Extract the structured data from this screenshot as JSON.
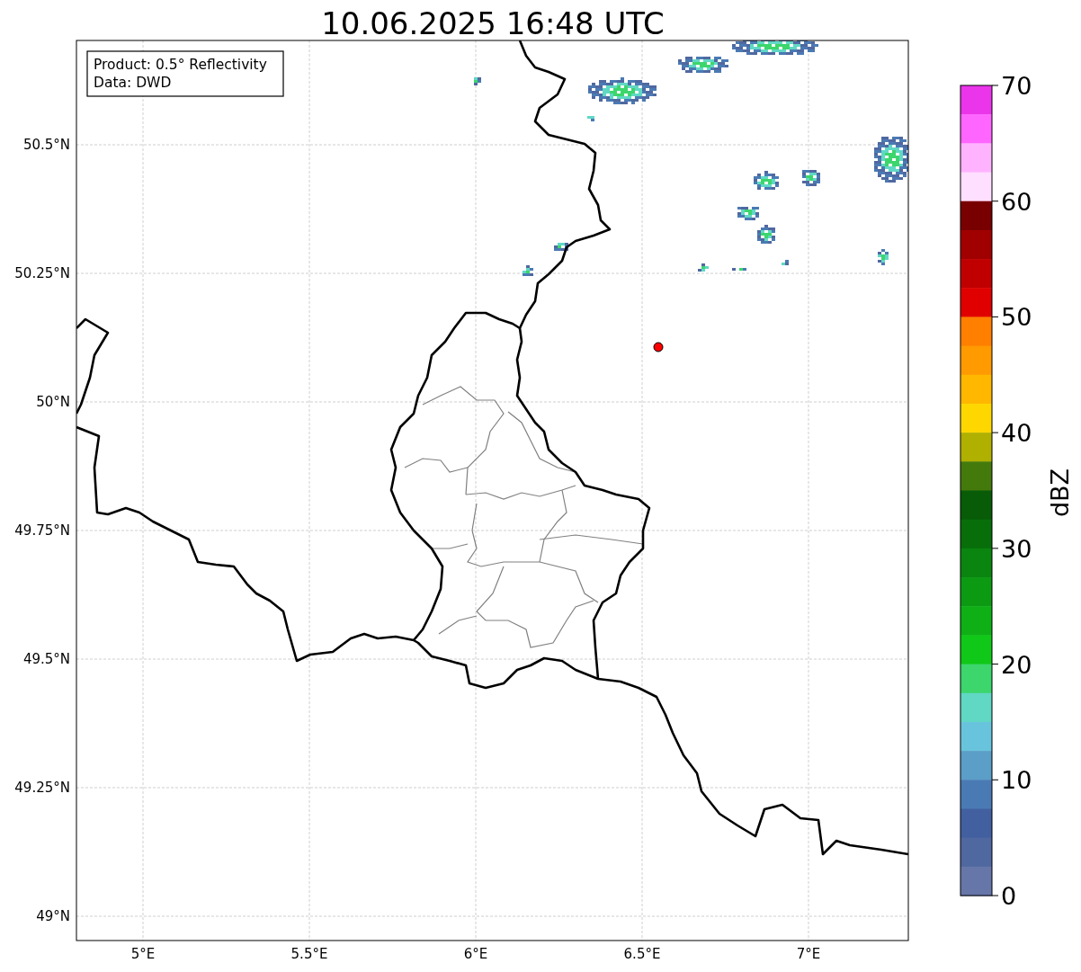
{
  "title": "10.06.2025 16:48 UTC",
  "info_box": {
    "lines": [
      "Product: 0.5° Reflectivity",
      "Data: DWD"
    ]
  },
  "map": {
    "x_ticks": [
      "5°E",
      "5.5°E",
      "6°E",
      "6.5°E",
      "7°E"
    ],
    "y_ticks": [
      "50.5°N",
      "50.25°N",
      "50°N",
      "49.75°N",
      "49.5°N",
      "49.25°N",
      "49°N"
    ]
  },
  "colorbar": {
    "label": "dBZ",
    "ticks": [
      "70",
      "60",
      "50",
      "40",
      "30",
      "20",
      "10",
      "0"
    ],
    "segments": [
      {
        "color": "#ea35ea"
      },
      {
        "color": "#ff66ff"
      },
      {
        "color": "#ffb3ff"
      },
      {
        "color": "#ffdfff"
      },
      {
        "color": "#780000"
      },
      {
        "color": "#a00000"
      },
      {
        "color": "#c00000"
      },
      {
        "color": "#e00000"
      },
      {
        "color": "#ff7f00"
      },
      {
        "color": "#ff9a00"
      },
      {
        "color": "#ffb700"
      },
      {
        "color": "#ffd700"
      },
      {
        "color": "#b0b000"
      },
      {
        "color": "#447a0c"
      },
      {
        "color": "#085c08"
      },
      {
        "color": "#086e0a"
      },
      {
        "color": "#0a8510"
      },
      {
        "color": "#0c9a12"
      },
      {
        "color": "#0eb016"
      },
      {
        "color": "#10c818"
      },
      {
        "color": "#3cd66c"
      },
      {
        "color": "#60d8c4"
      },
      {
        "color": "#68c4dc"
      },
      {
        "color": "#5b9ec8"
      },
      {
        "color": "#4a7ab4"
      },
      {
        "color": "#4260a0"
      },
      {
        "color": "#5068a0"
      },
      {
        "color": "#6676a8"
      }
    ]
  }
}
